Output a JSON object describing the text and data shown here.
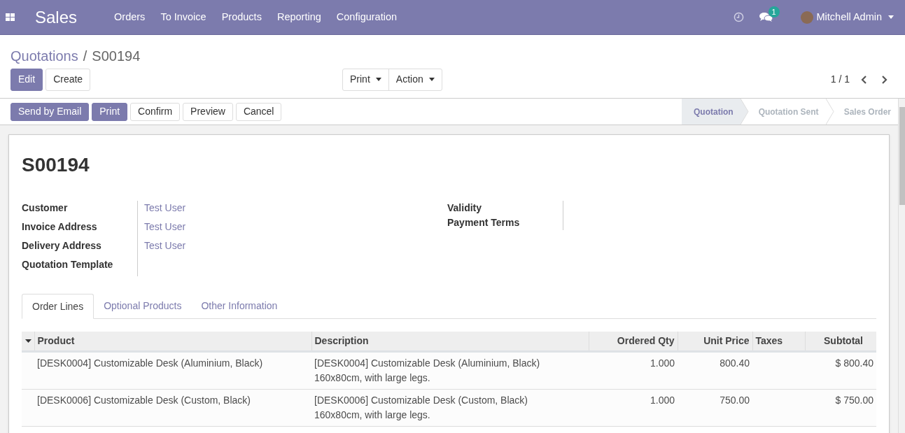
{
  "navbar": {
    "app": "Sales",
    "menu": [
      "Orders",
      "To Invoice",
      "Products",
      "Reporting",
      "Configuration"
    ],
    "message_count": "1",
    "user": "Mitchell Admin"
  },
  "breadcrumb": {
    "parent": "Quotations",
    "separator": "/",
    "current": "S00194"
  },
  "control_buttons": [
    {
      "label": "Edit",
      "primary": true
    },
    {
      "label": "Create",
      "primary": false
    }
  ],
  "dropdowns": [
    "Print",
    "Action"
  ],
  "pager": "1 / 1",
  "status_buttons": [
    {
      "label": "Send by Email",
      "primary": true
    },
    {
      "label": "Print",
      "primary": true
    },
    {
      "label": "Confirm",
      "primary": false
    },
    {
      "label": "Preview",
      "primary": false
    },
    {
      "label": "Cancel",
      "primary": false
    }
  ],
  "stages": [
    {
      "label": "Quotation",
      "selected": true
    },
    {
      "label": "Quotation Sent",
      "selected": false
    },
    {
      "label": "Sales Order",
      "selected": false
    }
  ],
  "title": "S00194",
  "left_fields": [
    {
      "label": "Customer",
      "value": "Test User"
    },
    {
      "label": "Invoice Address",
      "value": "Test User"
    },
    {
      "label": "Delivery Address",
      "value": "Test User"
    },
    {
      "label": "Quotation Template"
    }
  ],
  "right_fields": [
    {
      "label": "Validity"
    },
    {
      "label": "Payment Terms"
    }
  ],
  "tabs": [
    {
      "label": "Order Lines",
      "selected": true
    },
    {
      "label": "Optional Products",
      "selected": false
    },
    {
      "label": "Other Information",
      "selected": false
    }
  ],
  "table": {
    "columns": [
      "Product",
      "Description",
      "Ordered Qty",
      "Unit Price",
      "Taxes",
      "Subtotal"
    ],
    "rows": [
      {
        "product": "[DESK0004] Customizable Desk (Aluminium, Black)",
        "description": [
          "[DESK0004] Customizable Desk (Aluminium, Black)",
          "160x80cm, with large legs."
        ],
        "qty": "1.000",
        "price": "800.40",
        "subtotal": "$ 800.40"
      },
      {
        "product": "[DESK0006] Customizable Desk (Custom, Black)",
        "description": [
          "[DESK0006] Customizable Desk (Custom, Black)",
          "160x80cm, with large legs."
        ],
        "qty": "1.000",
        "price": "750.00",
        "subtotal": "$ 750.00"
      }
    ]
  }
}
